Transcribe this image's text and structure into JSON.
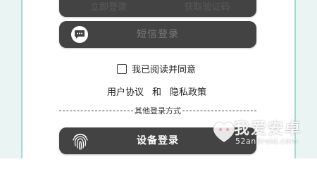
{
  "top_buttons": {
    "left_label": "立即登录",
    "right_label": "获取验证码"
  },
  "sms_login": {
    "label": "短信登录",
    "icon": "chat-bubble-icon"
  },
  "agreement": {
    "text": "我已阅读并同意",
    "checked": false
  },
  "policies": {
    "user_agreement": "用户协议",
    "and": "和",
    "privacy_policy": "隐私政策"
  },
  "other_login": {
    "divider_text": "其他登录方式"
  },
  "device_login": {
    "label": "设备登录",
    "icon": "fingerprint-icon"
  },
  "watermark": {
    "brand": "我爱安卓",
    "url": "52android.com"
  },
  "colors": {
    "pill": "#434343",
    "frame_accent": "#a7d9cf"
  }
}
